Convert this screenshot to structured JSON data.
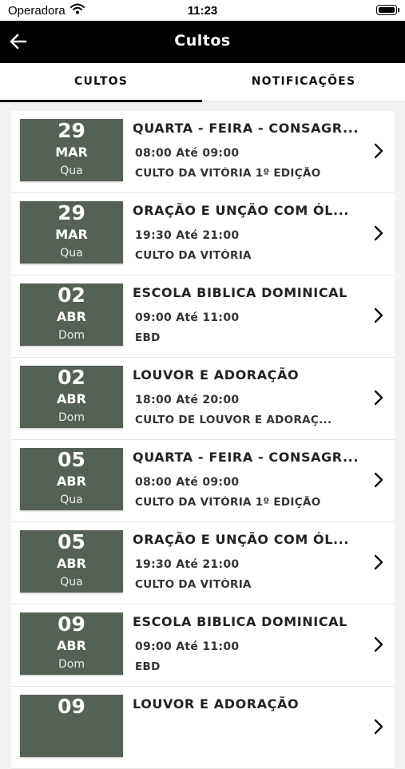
{
  "status_bar": {
    "carrier": "Operadora",
    "time": "11:23"
  },
  "header": {
    "title": "Cultos"
  },
  "tabs": [
    {
      "label": "CULTOS"
    },
    {
      "label": "NOTIFICAÇÕES"
    }
  ],
  "events": [
    {
      "day": "29",
      "month": "MAR",
      "weekday": "Qua",
      "name": "QUARTA - FEIRA - CONSAGR...",
      "time": "08:00 Até 09:00",
      "description": "CULTO DA VITÓRIA 1º EDIÇÃO"
    },
    {
      "day": "29",
      "month": "MAR",
      "weekday": "Qua",
      "name": "ORAÇÃO E UNÇÃO COM ÓL...",
      "time": "19:30 Até 21:00",
      "description": "CULTO DA VITÓRIA"
    },
    {
      "day": "02",
      "month": "ABR",
      "weekday": "Dom",
      "name": "ESCOLA BIBLICA DOMINICAL",
      "time": "09:00 Até 11:00",
      "description": "EBD"
    },
    {
      "day": "02",
      "month": "ABR",
      "weekday": "Dom",
      "name": "LOUVOR E ADORAÇÃO",
      "time": "18:00 Até 20:00",
      "description": "CULTO DE LOUVOR E ADORAÇ..."
    },
    {
      "day": "05",
      "month": "ABR",
      "weekday": "Qua",
      "name": "QUARTA - FEIRA - CONSAGR...",
      "time": "08:00 Até 09:00",
      "description": "CULTO DA VITÓRIA 1º EDIÇÃO"
    },
    {
      "day": "05",
      "month": "ABR",
      "weekday": "Qua",
      "name": "ORAÇÃO E UNÇÃO COM ÓL...",
      "time": "19:30 Até 21:00",
      "description": "CULTO DA VITÓRIA"
    },
    {
      "day": "09",
      "month": "ABR",
      "weekday": "Dom",
      "name": "ESCOLA BIBLICA DOMINICAL",
      "time": "09:00 Até 11:00",
      "description": "EBD"
    },
    {
      "day": "09",
      "month": "",
      "weekday": "",
      "name": "LOUVOR E ADORAÇÃO",
      "time": "",
      "description": ""
    }
  ],
  "colors": {
    "date_box": "#566156",
    "header_bg": "#000000"
  }
}
